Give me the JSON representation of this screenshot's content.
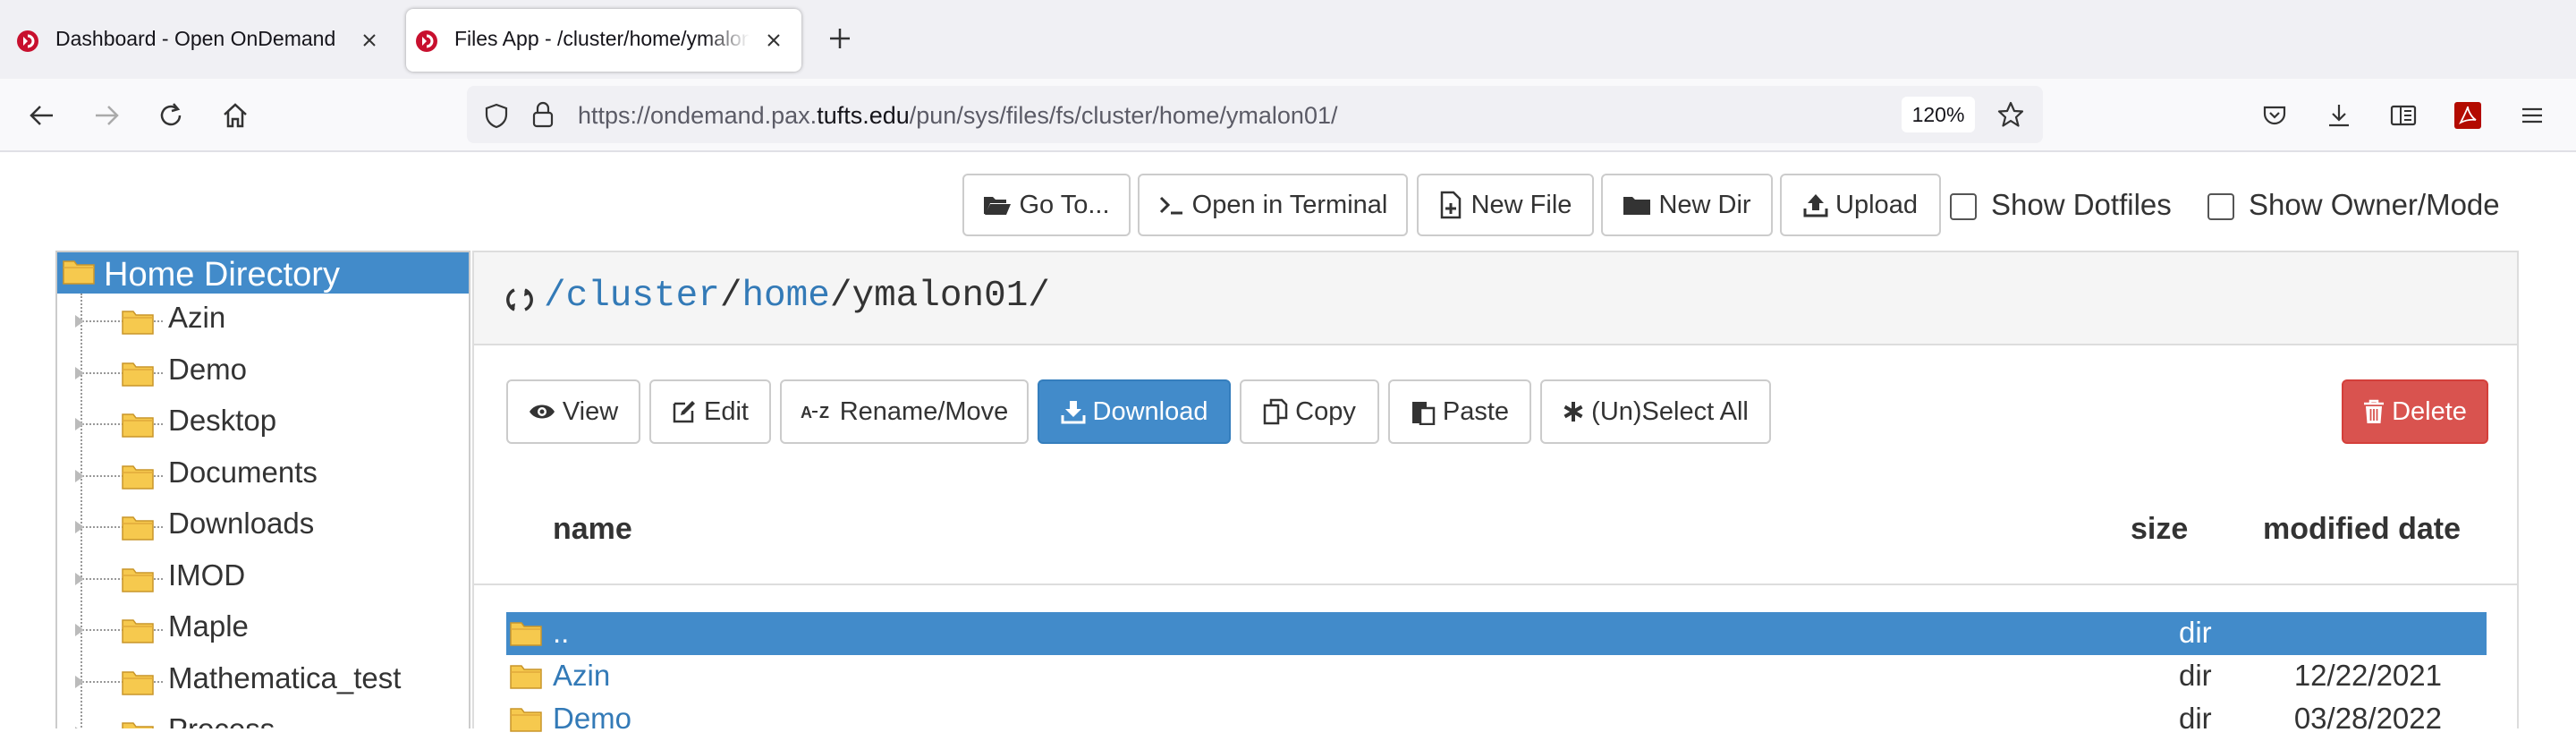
{
  "browser": {
    "tabs": [
      {
        "title": "Dashboard - Open OnDemand",
        "active": false
      },
      {
        "title": "Files App - /cluster/home/ymalon01/",
        "active": true
      }
    ],
    "url_prefix": "https://ondemand.pax.",
    "url_host": "tufts.edu",
    "url_path": "/pun/sys/files/fs/cluster/home/ymalon01/",
    "zoom": "120%"
  },
  "toolbar": {
    "goto": "Go To...",
    "terminal": "Open in Terminal",
    "new_file": "New File",
    "new_dir": "New Dir",
    "upload": "Upload",
    "show_dotfiles": "Show Dotfiles",
    "show_owner": "Show Owner/Mode"
  },
  "tree": {
    "root": "Home Directory",
    "items": [
      "Azin",
      "Demo",
      "Desktop",
      "Documents",
      "Downloads",
      "IMOD",
      "Maple",
      "Mathematica_test",
      "Process"
    ]
  },
  "path": {
    "seg1": "/cluster",
    "sep1": "/",
    "seg2": "home",
    "rest": "/ymalon01/"
  },
  "actions": {
    "view": "View",
    "edit": "Edit",
    "rename": "Rename/Move",
    "download": "Download",
    "copy": "Copy",
    "paste": "Paste",
    "select_all": "(Un)Select All",
    "delete": "Delete"
  },
  "table": {
    "headers": {
      "name": "name",
      "size": "size",
      "modified": "modified date"
    },
    "rows": [
      {
        "name": "..",
        "size": "dir",
        "date": ""
      },
      {
        "name": "Azin",
        "size": "dir",
        "date": "12/22/2021"
      },
      {
        "name": "Demo",
        "size": "dir",
        "date": "03/28/2022"
      }
    ]
  },
  "colors": {
    "primary": "#428bca",
    "danger": "#d9534f",
    "link": "#337ab7",
    "folder": "#f6c94e"
  }
}
